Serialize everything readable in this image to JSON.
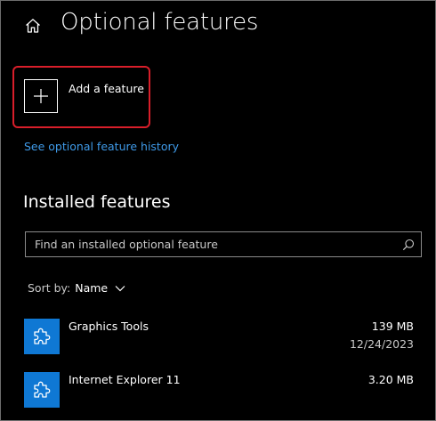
{
  "page": {
    "title": "Optional features"
  },
  "add_feature": {
    "label": "Add a feature"
  },
  "history_link": {
    "label": "See optional feature history"
  },
  "installed": {
    "heading": "Installed features",
    "search_placeholder": "Find an installed optional feature",
    "search_value": "",
    "sort_label": "Sort by:",
    "sort_value": "Name",
    "items": [
      {
        "name": "Graphics Tools",
        "size": "139 MB",
        "date": "12/24/2023"
      },
      {
        "name": "Internet Explorer 11",
        "size": "3.20 MB",
        "date": ""
      }
    ]
  },
  "colors": {
    "background": "#000000",
    "accent": "#0f78d4",
    "link": "#3f9ae8",
    "highlight": "#d81e2a"
  },
  "icons": {
    "home": "home-icon",
    "add": "plus-icon",
    "search": "search-icon",
    "sort": "chevron-down-icon",
    "feature": "puzzle-piece-icon"
  }
}
